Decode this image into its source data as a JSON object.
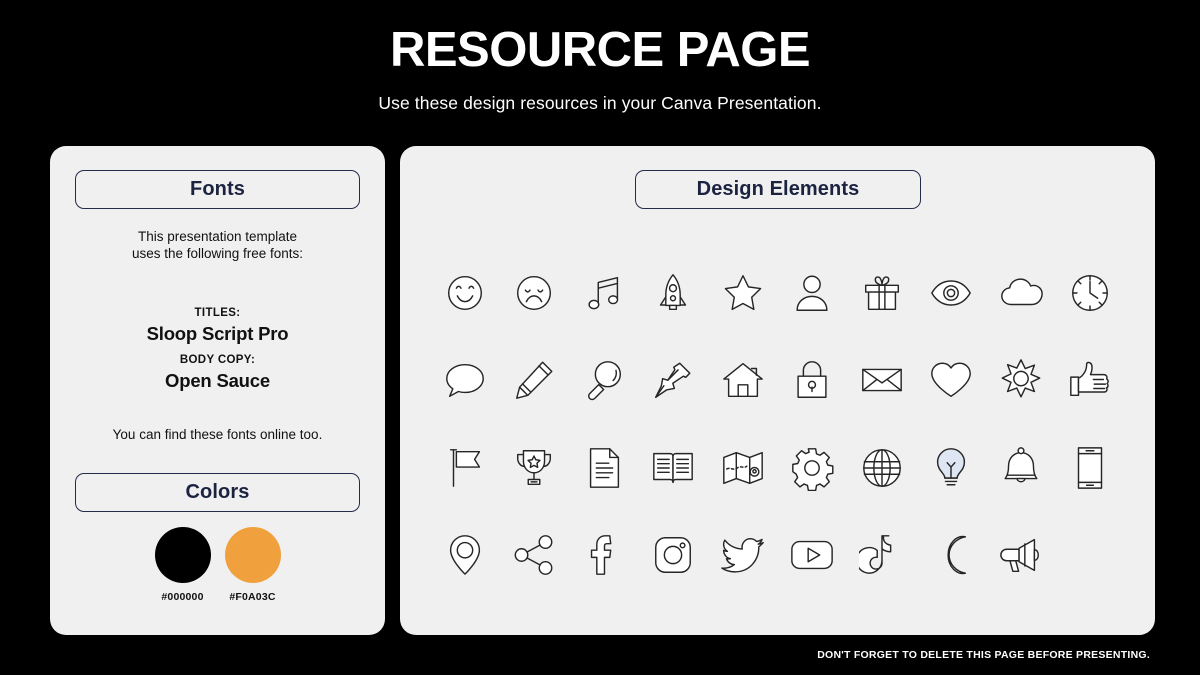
{
  "header": {
    "title": "RESOURCE PAGE",
    "subtitle": "Use these design resources in your Canva Presentation."
  },
  "fonts_panel": {
    "heading": "Fonts",
    "intro": "This presentation template\nuses the following free fonts:",
    "titles_role": "TITLES:",
    "titles_font": "Sloop Script Pro",
    "body_role": "BODY COPY:",
    "body_font": "Open Sauce",
    "outro": "You can find these fonts online too."
  },
  "colors_panel": {
    "heading": "Colors",
    "swatches": [
      {
        "hex": "#000000",
        "label": "#000000"
      },
      {
        "hex": "#F0A03C",
        "label": "#F0A03C"
      }
    ]
  },
  "design_panel": {
    "heading": "Design Elements",
    "icons": [
      "smiley-face-icon",
      "sad-face-icon",
      "music-note-icon",
      "rocket-icon",
      "star-icon",
      "person-icon",
      "gift-icon",
      "eye-icon",
      "cloud-icon",
      "clock-icon",
      "speech-bubble-icon",
      "pencil-icon",
      "magnifying-glass-icon",
      "pushpin-icon",
      "house-icon",
      "lock-icon",
      "envelope-icon",
      "heart-icon",
      "sun-icon",
      "thumbs-up-icon",
      "flag-icon",
      "trophy-icon",
      "document-icon",
      "open-book-icon",
      "folded-map-icon",
      "gear-icon",
      "globe-icon",
      "lightbulb-icon",
      "bell-icon",
      "smartphone-icon",
      "location-pin-icon",
      "share-icon",
      "facebook-icon",
      "instagram-icon",
      "twitter-icon",
      "youtube-icon",
      "tiktok-icon",
      "moon-icon",
      "megaphone-icon"
    ]
  },
  "footer": {
    "note": "DON'T FORGET TO DELETE THIS PAGE BEFORE PRESENTING."
  },
  "palette": {
    "background": "#000000",
    "panel": "#F0F0F0",
    "pill_border": "#252B4A",
    "pill_text": "#1B2340",
    "icon_stroke": "#262626",
    "accent_orange": "#F0A03C"
  }
}
